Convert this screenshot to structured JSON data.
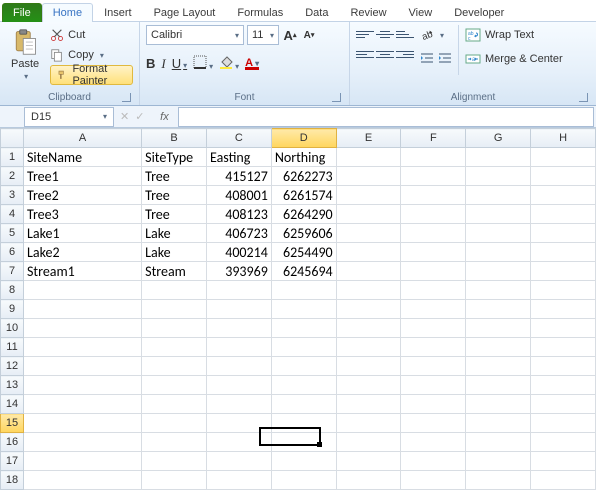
{
  "tabs": {
    "file": "File",
    "home": "Home",
    "insert": "Insert",
    "pagelayout": "Page Layout",
    "formulas": "Formulas",
    "data": "Data",
    "review": "Review",
    "view": "View",
    "developer": "Developer"
  },
  "ribbon": {
    "clipboard": {
      "paste": "Paste",
      "cut": "Cut",
      "copy": "Copy",
      "format_painter": "Format Painter",
      "label": "Clipboard"
    },
    "font": {
      "name": "Calibri",
      "size": "11",
      "bold": "B",
      "italic": "I",
      "underline": "U",
      "grow": "A",
      "shrink": "A",
      "fontcolor_letter": "A",
      "label": "Font"
    },
    "alignment": {
      "wrap": "Wrap Text",
      "merge": "Merge & Center",
      "label": "Alignment"
    }
  },
  "namebox": "D15",
  "columns": [
    "A",
    "B",
    "C",
    "D",
    "E",
    "F",
    "G",
    "H"
  ],
  "rows": [
    "1",
    "2",
    "3",
    "4",
    "5",
    "6",
    "7",
    "8",
    "9",
    "10",
    "11",
    "12",
    "13",
    "14",
    "15",
    "16",
    "17",
    "18"
  ],
  "cells": {
    "r1": {
      "A": "SiteName",
      "B": "SiteType",
      "C": "Easting",
      "D": "Northing"
    },
    "r2": {
      "A": "Tree1",
      "B": "Tree",
      "C": "415127",
      "D": "6262273"
    },
    "r3": {
      "A": "Tree2",
      "B": "Tree",
      "C": "408001",
      "D": "6261574"
    },
    "r4": {
      "A": "Tree3",
      "B": "Tree",
      "C": "408123",
      "D": "6264290"
    },
    "r5": {
      "A": "Lake1",
      "B": "Lake",
      "C": "406723",
      "D": "6259606"
    },
    "r6": {
      "A": "Lake2",
      "B": "Lake",
      "C": "400214",
      "D": "6254490"
    },
    "r7": {
      "A": "Stream1",
      "B": "Stream",
      "C": "393969",
      "D": "6245694"
    }
  },
  "active": {
    "col": "D",
    "row": "15"
  }
}
